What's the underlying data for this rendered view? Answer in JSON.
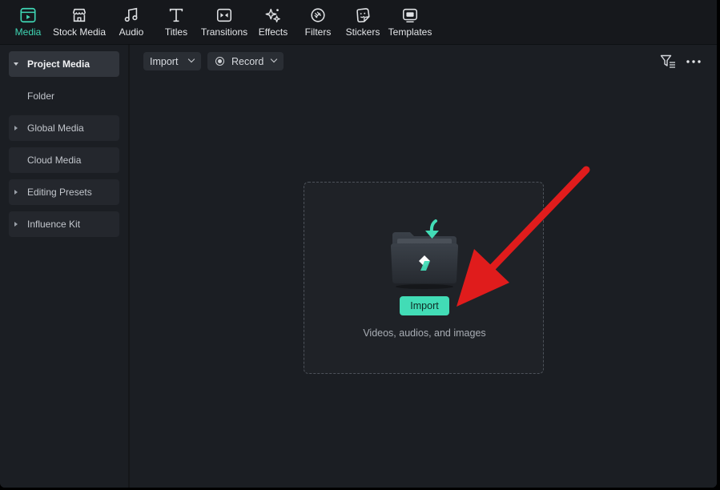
{
  "toolbar": {
    "items": [
      {
        "label": "Media",
        "icon": "media-icon",
        "active": true
      },
      {
        "label": "Stock Media",
        "icon": "stock-media-icon"
      },
      {
        "label": "Audio",
        "icon": "music-note-icon"
      },
      {
        "label": "Titles",
        "icon": "title-t-icon"
      },
      {
        "label": "Transitions",
        "icon": "transitions-icon"
      },
      {
        "label": "Effects",
        "icon": "effects-sparkle-icon"
      },
      {
        "label": "Filters",
        "icon": "filters-icon"
      },
      {
        "label": "Stickers",
        "icon": "stickers-icon"
      },
      {
        "label": "Templates",
        "icon": "templates-icon"
      }
    ]
  },
  "sidebar": {
    "items": [
      {
        "label": "Project Media",
        "expanded": true,
        "active": true
      },
      {
        "label": "Folder"
      },
      {
        "label": "Global Media",
        "expandable": true
      },
      {
        "label": "Cloud Media"
      },
      {
        "label": "Editing Presets",
        "expandable": true
      },
      {
        "label": "Influence Kit",
        "expandable": true
      }
    ]
  },
  "media_toolbar": {
    "import_label": "Import",
    "record_label": "Record"
  },
  "dropzone": {
    "import_button_label": "Import",
    "hint": "Videos, audios, and images"
  },
  "colors": {
    "accent": "#42dcb6",
    "annotation_arrow": "#e01c1c",
    "background": "#1b1e23"
  }
}
